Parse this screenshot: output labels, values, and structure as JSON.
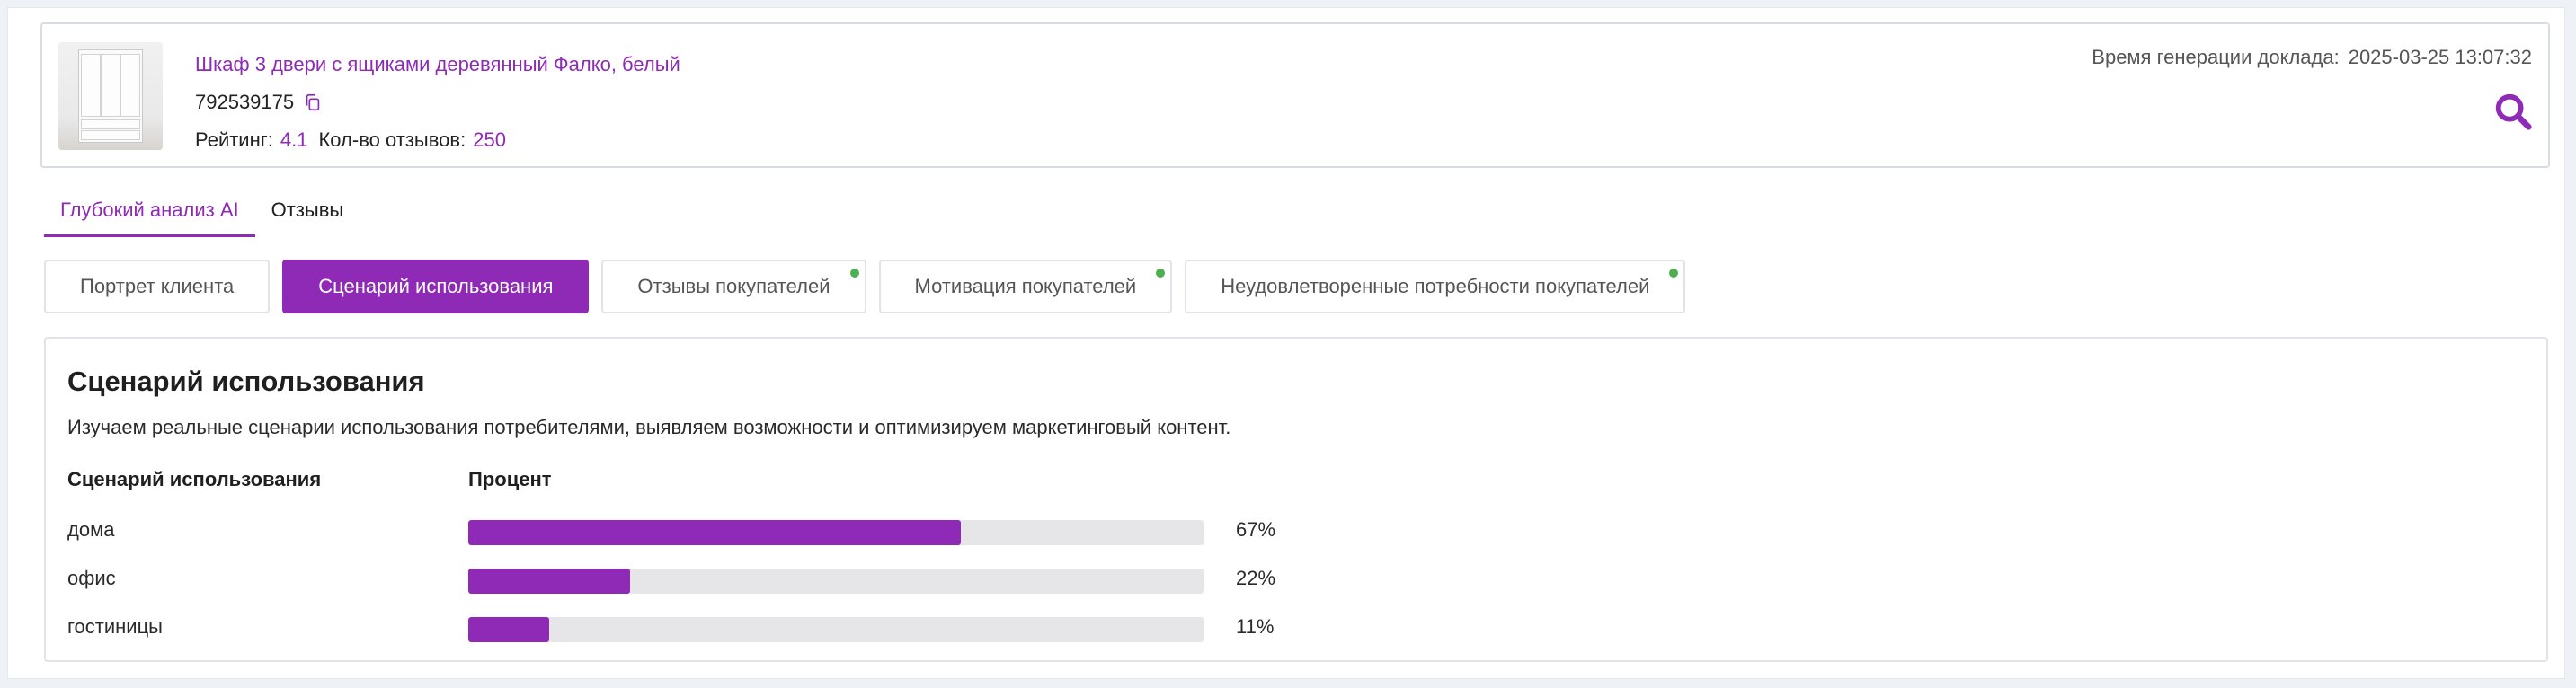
{
  "product": {
    "title": "Шкаф 3 двери с ящиками деревянный Фалко, белый",
    "sku": "792539175",
    "rating_label": "Рейтинг:",
    "rating_value": "4.1",
    "reviews_label": "Кол-во отзывов:",
    "reviews_value": "250",
    "generated_label": "Время генерации доклада:",
    "generated_value": "2025-03-25 13:07:32"
  },
  "tabs": [
    {
      "label": "Глубокий анализ AI",
      "active": true
    },
    {
      "label": "Отзывы",
      "active": false
    }
  ],
  "subtabs": [
    {
      "label": "Портрет клиента",
      "active": false,
      "dot": false
    },
    {
      "label": "Сценарий использования",
      "active": true,
      "dot": false
    },
    {
      "label": "Отзывы покупателей",
      "active": false,
      "dot": true
    },
    {
      "label": "Мотивация покупателей",
      "active": false,
      "dot": true
    },
    {
      "label": "Неудовлетворенные потребности покупателей",
      "active": false,
      "dot": true
    }
  ],
  "analysis": {
    "title": "Сценарий использования",
    "description": "Изучаем реальные сценарии использования потребителями, выявляем возможности и оптимизируем маркетинговый контент.",
    "col_scenario": "Сценарий использования",
    "col_percent": "Процент",
    "rows": [
      {
        "label": "дома",
        "percent": 67,
        "percent_text": "67%"
      },
      {
        "label": "офис",
        "percent": 22,
        "percent_text": "22%"
      },
      {
        "label": "гостиницы",
        "percent": 11,
        "percent_text": "11%"
      }
    ]
  },
  "colors": {
    "accent": "#8e2ab5",
    "bar_track": "#e6e6e8",
    "status_dot": "#4caf50"
  },
  "icons": {
    "copy": "copy-icon",
    "search": "search-icon"
  }
}
